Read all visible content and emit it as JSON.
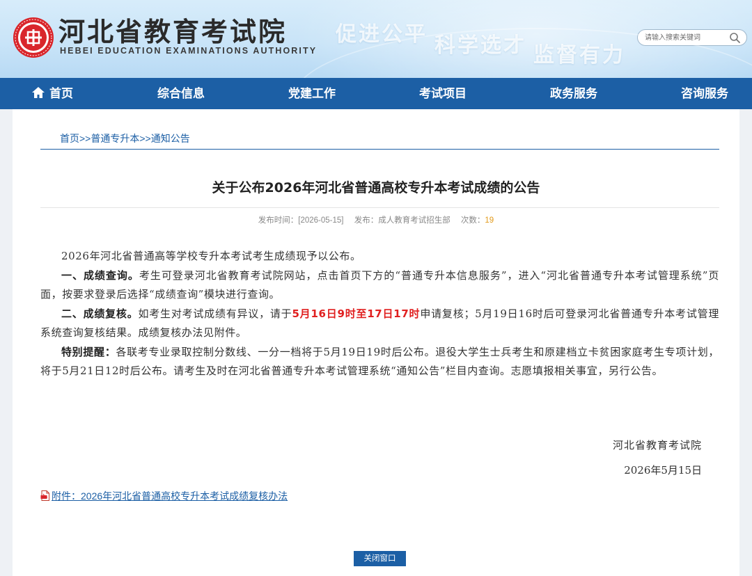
{
  "header": {
    "site_title": "河北省教育考试院",
    "site_subtitle": "HEBEI EDUCATION EXAMINATIONS AUTHORITY",
    "slogans": [
      "促进公平",
      "科学选才",
      "监督有力"
    ],
    "search_placeholder": "请输入搜索关键词"
  },
  "nav": {
    "items": [
      {
        "label": "首页",
        "icon": "home-icon"
      },
      {
        "label": "综合信息"
      },
      {
        "label": "党建工作"
      },
      {
        "label": "考试项目"
      },
      {
        "label": "政务服务"
      },
      {
        "label": "咨询服务"
      }
    ]
  },
  "breadcrumb": {
    "items": [
      "首页",
      "普通专升本",
      "通知公告"
    ],
    "separator": ">>"
  },
  "article": {
    "title": "关于公布2026年河北省普通高校专升本考试成绩的公告",
    "meta": {
      "publish_time": "发布时间：[2026-05-15]",
      "publisher": "发布：成人教育考试招生部",
      "views_label": "次数：",
      "views": "19"
    },
    "intro": "2026年河北省普通高等学校专升本考试考生成绩现予以公布。",
    "section1_heading": "一、成绩查询。",
    "section1_text": "考生可登录河北省教育考试院网站，点击首页下方的“普通专升本信息服务”，进入“河北省普通专升本考试管理系统”页面，按要求登录后选择“成绩查询”模块进行查询。",
    "section2_heading": "二、成绩复核。",
    "section2_pre": "如考生对考试成绩有异议，请于",
    "section2_highlight": "5月16日9时至17日17时",
    "section2_post": "申请复核；5月19日16时后可登录河北省普通专升本考试管理系统查询复核结果。成绩复核办法见附件。",
    "section3_heading": "特别提醒：",
    "section3_text": "各联考专业录取控制分数线、一分一档将于5月19日19时后公布。退役大学生士兵考生和原建档立卡贫困家庭考生专项计划，将于5月21日12时后公布。请考生及时在河北省普通专升本考试管理系统“通知公告”栏目内查询。志愿填报相关事宜，另行公告。",
    "sign_org": "河北省教育考试院",
    "sign_date": "2026年5月15日",
    "attachment": "附件：2026年河北省普通高校专升本考试成绩复核办法"
  },
  "close_button": "关闭窗口",
  "colors": {
    "nav_bg": "#1c5fa5",
    "highlight_red": "#e02020",
    "views_orange": "#e29a1a"
  }
}
